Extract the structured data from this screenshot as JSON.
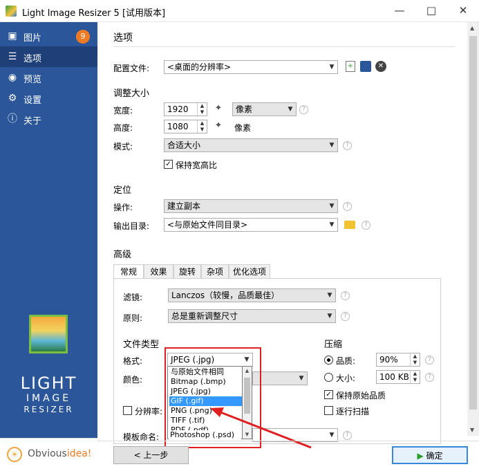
{
  "window": {
    "title": "Light Image Resizer 5  [试用版本]"
  },
  "sidebar": {
    "items": [
      {
        "label": "图片",
        "badge": "9"
      },
      {
        "label": "选项"
      },
      {
        "label": "预览"
      },
      {
        "label": "设置"
      },
      {
        "label": "关于"
      }
    ],
    "logo_line1": "LIGHT",
    "logo_line2": "IMAGE",
    "logo_line3": "RESIZER",
    "brand_prefix": "Obvious",
    "brand_suffix": "idea!"
  },
  "main": {
    "title": "选项",
    "profile_label": "配置文件:",
    "profile_value": "<桌面的分辨率>",
    "resize_section": "调整大小",
    "width_label": "宽度:",
    "width_value": "1920",
    "height_label": "高度:",
    "height_value": "1080",
    "unit_value": "像素",
    "unit_static": "像素",
    "mode_label": "模式:",
    "mode_value": "合适大小",
    "keep_ratio_label": "保持宽高比",
    "position_section": "定位",
    "operation_label": "操作:",
    "operation_value": "建立副本",
    "output_label": "输出目录:",
    "output_value": "<与原始文件同目录>",
    "advanced_section": "高级",
    "tabs": [
      "常规",
      "效果",
      "旋转",
      "杂项",
      "优化选项"
    ],
    "filter_label": "滤镜:",
    "filter_value": "Lanczos（较慢，品质最佳）",
    "rule_label": "原则:",
    "rule_value": "总是重新调整尺寸",
    "filetype_section": "文件类型",
    "format_label": "格式:",
    "format_value": "JPEG (.jpg)",
    "color_label": "颜色:",
    "resolution_label": "分辨率:",
    "template_label": "模板命名:",
    "format_options": [
      "与原始文件相同",
      "Bitmap (.bmp)",
      "JPEG (.jpg)",
      "GIF (.gif)",
      "PNG (.png)",
      "TIFF (.tif)",
      "PDF (.pdf)",
      "Photoshop (.psd)"
    ],
    "compress_section": "压缩",
    "quality_label": "品质:",
    "quality_value": "90%",
    "size_label": "大小:",
    "size_value": "100 KB",
    "keep_quality_label": "保持原始品质",
    "progressive_label": "逐行扫描"
  },
  "footer": {
    "back_label": "< 上一步",
    "ok_label": "确定"
  },
  "colors": {
    "sidebar": "#2b579a",
    "sidebar_active": "#1f3f78",
    "badge": "#f07a24",
    "highlight": "#e02020",
    "selection": "#3399ff"
  }
}
